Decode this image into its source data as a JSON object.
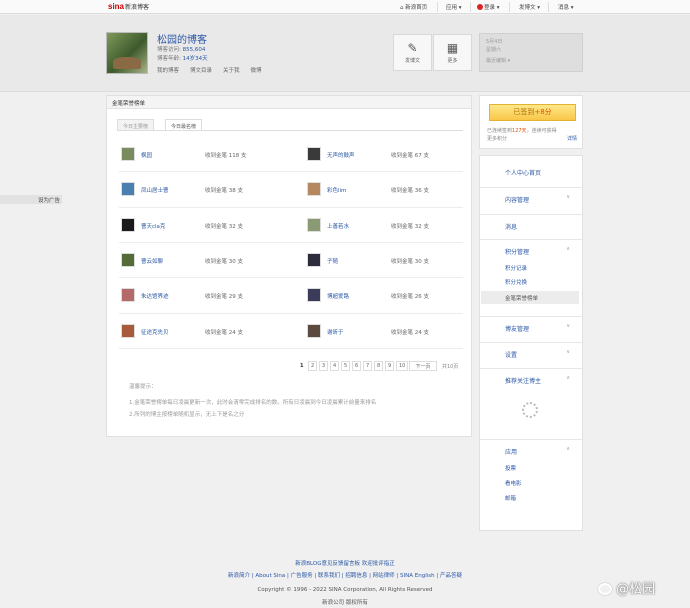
{
  "topnav": {
    "logo_brand": "sina",
    "logo_sub": "新浪博客",
    "home": "新浪首页",
    "app": "应用",
    "login": "登录",
    "publish": "发博文",
    "msg": "消息"
  },
  "header": {
    "blog_title": "松园的博客",
    "visits_label": "博客访问:",
    "visits_value": "855,604",
    "age_label": "博客年龄:",
    "age_value": "14岁34天",
    "links": [
      "我的博客",
      "博文目录",
      "关于我",
      "微博"
    ],
    "quick": [
      {
        "label": "发博文",
        "icon": "✎"
      },
      {
        "label": "更多",
        "icon": "▦"
      }
    ],
    "date": "5月4日",
    "weekday": "星期六",
    "weather_link": "最近编辑"
  },
  "side_ad": "设为广告",
  "main": {
    "header_title": "金笔荣誉榜单",
    "tabs": [
      "今日主要榜",
      "今日最名榜"
    ],
    "entries": [
      {
        "name": "枫园",
        "count": "收到金笔  118  支",
        "color": "#7a8c5e"
      },
      {
        "name": "无声的鼓声",
        "count": "收到金笔  67  支",
        "color": "#3a3a3a"
      },
      {
        "name": "凤山居士曹",
        "count": "收到金笔  38  支",
        "color": "#4a7fb0"
      },
      {
        "name": "彩色lim",
        "count": "收到金笔  36  支",
        "color": "#b58860"
      },
      {
        "name": "曹天cla克",
        "count": "收到金笔  32  支",
        "color": "#1a1a1a"
      },
      {
        "name": "上善若水",
        "count": "收到金笔  32  支",
        "color": "#8a9a74"
      },
      {
        "name": "曹云如聊",
        "count": "收到金笔  30  支",
        "color": "#556b3a"
      },
      {
        "name": "子随",
        "count": "收到金笔  30  支",
        "color": "#2c2c3c"
      },
      {
        "name": "朱达馆界迹",
        "count": "收到金笔  29  支",
        "color": "#b56a6a"
      },
      {
        "name": "博超爱路",
        "count": "收到金笔  26  支",
        "color": "#3b3b5a"
      },
      {
        "name": "征途克先贝",
        "count": "收到金笔  24  支",
        "color": "#a85b3a"
      },
      {
        "name": "谢昕于",
        "count": "收到金笔  24  支",
        "color": "#5a4a40"
      }
    ],
    "pager": {
      "pages": [
        "1",
        "2",
        "3",
        "4",
        "5",
        "6",
        "7",
        "8",
        "9",
        "10"
      ],
      "next": "下一页",
      "total": "共10页"
    },
    "tips_title": "温馨提示：",
    "tips": [
      "1.金笔荣誉榜单每日凌晨更新一次，此时会清零完成排名的数。所有日凌晨到今日凌晨累计前量来排名",
      "2.所列的博主按榜单随机显示，无上下是名之分"
    ]
  },
  "sign": {
    "button_prefix": "已签到",
    "button_bonus": "+8分",
    "text_before": "已连续签到",
    "days": "127天",
    "text_after": "，连续可获得",
    "text_line2": "更多积分",
    "rule": "详情"
  },
  "menu": {
    "sections": [
      {
        "label": "个人中心首页",
        "arrow": ""
      },
      {
        "label": "内容管理",
        "arrow": "∨"
      },
      {
        "label": "消息",
        "arrow": ""
      },
      {
        "label": "积分管理",
        "arrow": "∧"
      },
      {
        "label": "博友管理",
        "arrow": "∨"
      },
      {
        "label": "设置",
        "arrow": "∨"
      },
      {
        "label": "推荐关注博主",
        "arrow": "∧"
      },
      {
        "label": "应用",
        "arrow": "∧"
      }
    ],
    "points_sub": [
      "积分记录",
      "积分兑换",
      "金笔荣誉榜单"
    ],
    "apps_sub": [
      "投票",
      "看电影",
      "邮箱"
    ]
  },
  "footer": {
    "line1": "新浪BLOG意见反馈留言板  欢迎批评指正",
    "line2": "新浪简介 | About Sina | 广告服务 | 联系我们 | 招聘信息 | 网站律师 | SINA English | 产品答疑",
    "line3": "Copyright © 1996 - 2022 SINA Corporation, All Rights Reserved",
    "line4": "新浪公司 版权所有"
  },
  "watermark": "@松园"
}
